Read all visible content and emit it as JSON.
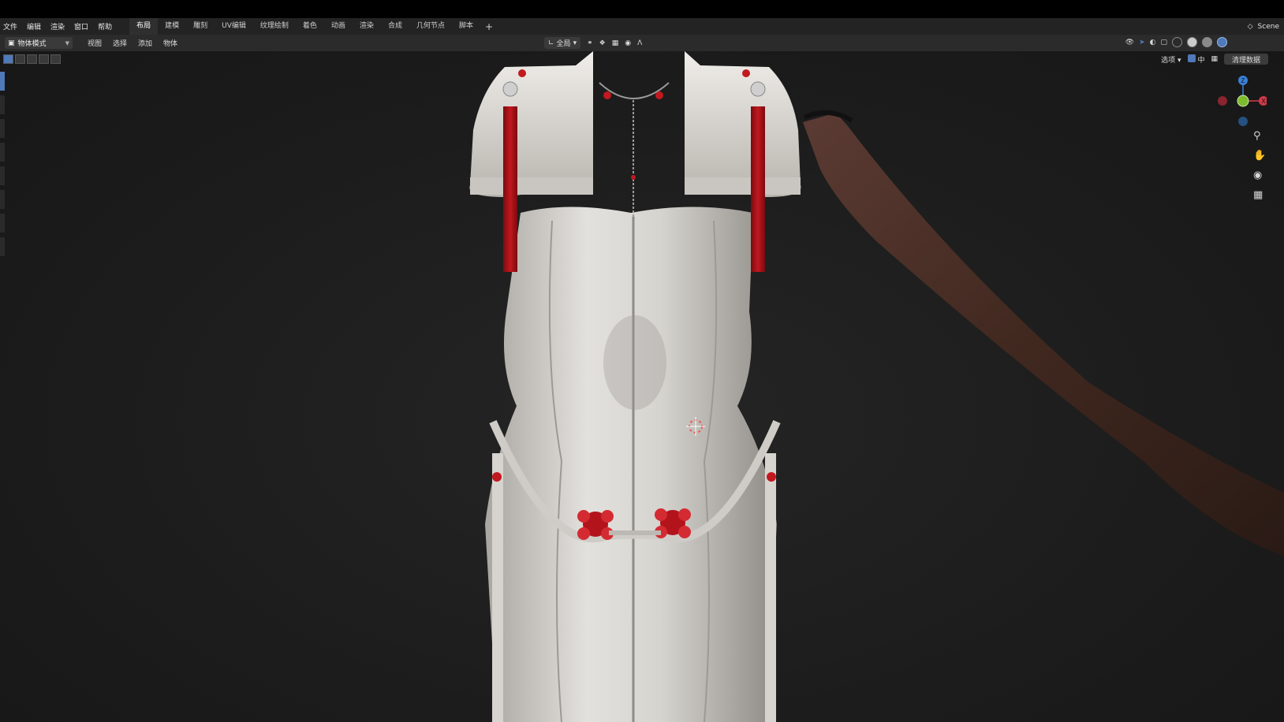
{
  "menu": [
    "文件",
    "编辑",
    "渲染",
    "窗口",
    "帮助"
  ],
  "workspaces": [
    {
      "label": "布局",
      "active": true
    },
    {
      "label": "建模",
      "active": false
    },
    {
      "label": "雕刻",
      "active": false
    },
    {
      "label": "UV编辑",
      "active": false
    },
    {
      "label": "纹理绘制",
      "active": false
    },
    {
      "label": "着色",
      "active": false
    },
    {
      "label": "动画",
      "active": false
    },
    {
      "label": "渲染",
      "active": false
    },
    {
      "label": "合成",
      "active": false
    },
    {
      "label": "几何节点",
      "active": false
    },
    {
      "label": "脚本",
      "active": false
    }
  ],
  "workspace_add": "+",
  "scene_name": "Scene",
  "header": {
    "mode": "物体模式",
    "menu": [
      "视图",
      "选择",
      "添加",
      "物体"
    ],
    "orientation": "全局"
  },
  "overlay": {
    "options_label": "选项",
    "center_label": "中",
    "clean_button": "清理数据"
  },
  "gizmo": {
    "x": "X",
    "y": "Y",
    "z": "Z"
  },
  "colors": {
    "accent": "#4f79b8",
    "axis_x": "#d4394a",
    "axis_y": "#7dbb2f",
    "axis_z": "#3a80d6",
    "dress": "#dcdad6",
    "tassel": "#b3141c",
    "glove": "#4a3029"
  },
  "icons": {
    "zoom": "zoom-icon",
    "pan": "hand-icon",
    "camera": "camera-icon",
    "grid": "grid-icon"
  }
}
